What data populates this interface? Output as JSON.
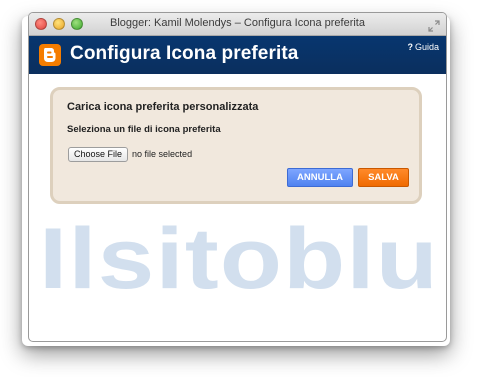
{
  "window": {
    "title": "Blogger: Kamil Molendys – Configura Icona preferita"
  },
  "header": {
    "title": "Configura Icona preferita",
    "help_icon": "?",
    "help_label": "Guida"
  },
  "panel": {
    "heading": "Carica icona preferita personalizzata",
    "subheading": "Seleziona un file di icona preferita",
    "file_input": {
      "button_label": "Choose File",
      "status": "no file selected"
    },
    "buttons": {
      "cancel_label": "ANNULLA",
      "save_label": "SALVA"
    }
  },
  "watermark": {
    "text": "Ilsitoblu"
  },
  "colors": {
    "header_bg": "#07366f",
    "logo_orange": "#f57d00",
    "panel_bg": "#f1e8dd",
    "panel_border": "#ddd0bd",
    "cancel_blue": "#5b8cf5",
    "save_orange": "#f57400",
    "watermark": "#c3d4e8"
  }
}
